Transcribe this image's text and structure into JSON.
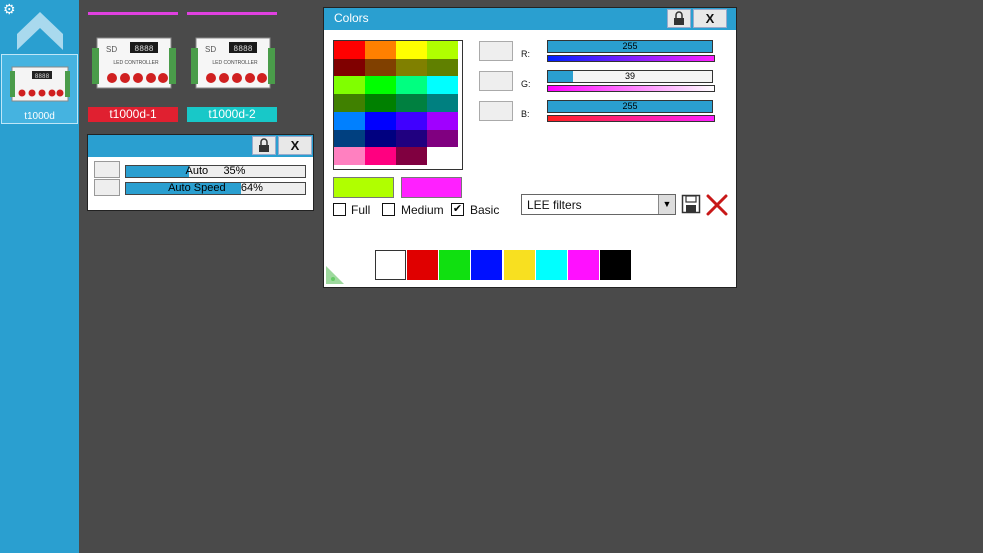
{
  "sidebar": {
    "gear_icon": "settings-gear-icon",
    "up_icon": "up-arrow-icon",
    "tile_label": "t1000d",
    "tile_display": "8888"
  },
  "devices": [
    {
      "name": "t1000d-1",
      "name_color": "#e02030",
      "bar_color": "#e040e0",
      "display": "8888",
      "caption": "LED CONTROLLER"
    },
    {
      "name": "t1000d-2",
      "name_color": "#18c8c8",
      "bar_color": "#e040e0",
      "display": "8888",
      "caption": "LED CONTROLLER"
    }
  ],
  "auto_panel": {
    "close_label": "X",
    "rows": [
      {
        "label": "Auto",
        "percent_text": "35%",
        "value": 0.35
      },
      {
        "label": "Auto Speed",
        "percent_text": "64%",
        "value": 0.64
      }
    ]
  },
  "colors_window": {
    "title": "Colors",
    "close_label": "X",
    "palette": [
      [
        "#ff0000",
        "#ff8000",
        "#ffff00",
        "#b0ff00"
      ],
      [
        "#800000",
        "#804000",
        "#808000",
        "#608000"
      ],
      [
        "#80ff00",
        "#00ff00",
        "#00ff80",
        "#00ffff"
      ],
      [
        "#408000",
        "#008000",
        "#008040",
        "#008080"
      ],
      [
        "#0080ff",
        "#0000ff",
        "#4000ff",
        "#a000ff"
      ],
      [
        "#004080",
        "#000080",
        "#200080",
        "#800080"
      ],
      [
        "#ff80c0",
        "#ff0080",
        "#800040",
        "#ffffff"
      ]
    ],
    "current_color": "#b0ff00",
    "previous_color": "#ff20ff",
    "channels": [
      {
        "label": "R:",
        "value": "255",
        "fraction": 1.0,
        "gradient_from": "#0020ff",
        "gradient_to": "#ff20ff"
      },
      {
        "label": "G:",
        "value": "39",
        "fraction": 0.153,
        "gradient_from": "#ff00ff",
        "gradient_to": "#ffffff"
      },
      {
        "label": "B:",
        "value": "255",
        "fraction": 1.0,
        "gradient_from": "#ff2020",
        "gradient_to": "#ff20ff"
      }
    ],
    "options": [
      {
        "label": "Full",
        "checked": false
      },
      {
        "label": "Medium",
        "checked": false
      },
      {
        "label": "Basic",
        "checked": true
      }
    ],
    "filter_select": "LEE filters",
    "quick_colors": [
      "#ffffff",
      "#e00000",
      "#10e010",
      "#0010ff",
      "#f8e020",
      "#00ffff",
      "#ff10ff",
      "#000000"
    ]
  }
}
